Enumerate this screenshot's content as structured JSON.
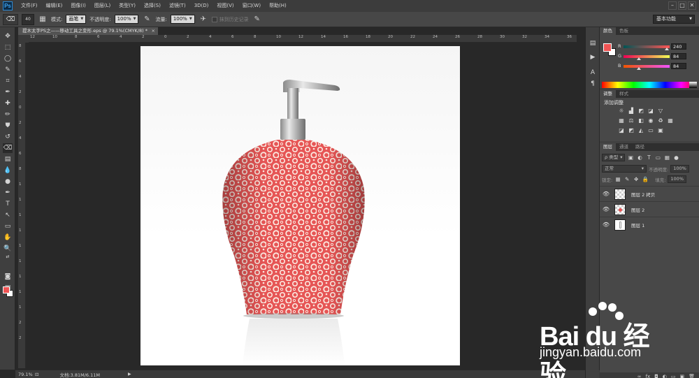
{
  "app": {
    "logo": "Ps"
  },
  "menu": [
    "文件(F)",
    "编辑(E)",
    "图像(I)",
    "图层(L)",
    "类型(Y)",
    "选择(S)",
    "滤镜(T)",
    "3D(D)",
    "视图(V)",
    "窗口(W)",
    "帮助(H)"
  ],
  "window_controls": {
    "minimize": "–",
    "restore": "□",
    "close": "✕"
  },
  "options": {
    "brush_size": "40",
    "mode_label": "模式:",
    "mode_value": "画笔",
    "opacity_label": "不透明度:",
    "opacity_value": "100%",
    "flow_label": "流量:",
    "flow_value": "100%",
    "erase_history_label": "抹到历史记录",
    "workspace": "基本功能"
  },
  "document_tab": {
    "title": "提木太字PS之——移动工具之变形.eps @ 79.1%(CMYK/8) *",
    "close": "×"
  },
  "ruler_top": [
    "12",
    "10",
    "8",
    "6",
    "4",
    "2",
    "0",
    "2",
    "4",
    "6",
    "8",
    "10",
    "12",
    "14",
    "16",
    "18",
    "20",
    "22",
    "24",
    "26",
    "28",
    "30",
    "32",
    "34",
    "36"
  ],
  "ruler_left": [
    "8",
    "6",
    "4",
    "2",
    "0",
    "2",
    "4",
    "6",
    "8",
    "1",
    "1",
    "1",
    "1",
    "1",
    "1",
    "1",
    "1",
    "1",
    "2",
    "2"
  ],
  "statusbar": {
    "zoom": "79.1%",
    "docinfo": "文档:3.81M/6.11M",
    "play": "▶"
  },
  "colors": {
    "foreground": "#f05454",
    "background": "#ffffff",
    "accent": "#2d8bd6"
  },
  "color_panel": {
    "tabs": [
      "颜色",
      "色板"
    ],
    "r": {
      "label": "R",
      "value": "240",
      "fraction": 0.94
    },
    "g": {
      "label": "G",
      "value": "84",
      "fraction": 0.33
    },
    "b": {
      "label": "B",
      "value": "84",
      "fraction": 0.33
    }
  },
  "adjust_panel": {
    "tabs": [
      "调整",
      "样式"
    ],
    "title": "添加调整"
  },
  "layers_panel": {
    "tabs": [
      "图层",
      "通道",
      "路径"
    ],
    "filter_label": "ρ 类型",
    "blend_mode": "正常",
    "opacity_label": "不透明度:",
    "opacity_value": "100%",
    "lock_label": "锁定:",
    "fill_label": "填充:",
    "fill_value": "100%",
    "layers": [
      {
        "name": "图层 2 拷贝",
        "visible": "👁"
      },
      {
        "name": "图层 2",
        "visible": "👁"
      },
      {
        "name": "图层 1",
        "visible": "👁"
      }
    ],
    "footer": [
      "∞",
      "fx",
      "◘",
      "◐",
      "▭",
      "▣",
      "🗑"
    ]
  },
  "watermark": {
    "logo": "Bai du 经验",
    "url": "jingyan.baidu.com"
  }
}
